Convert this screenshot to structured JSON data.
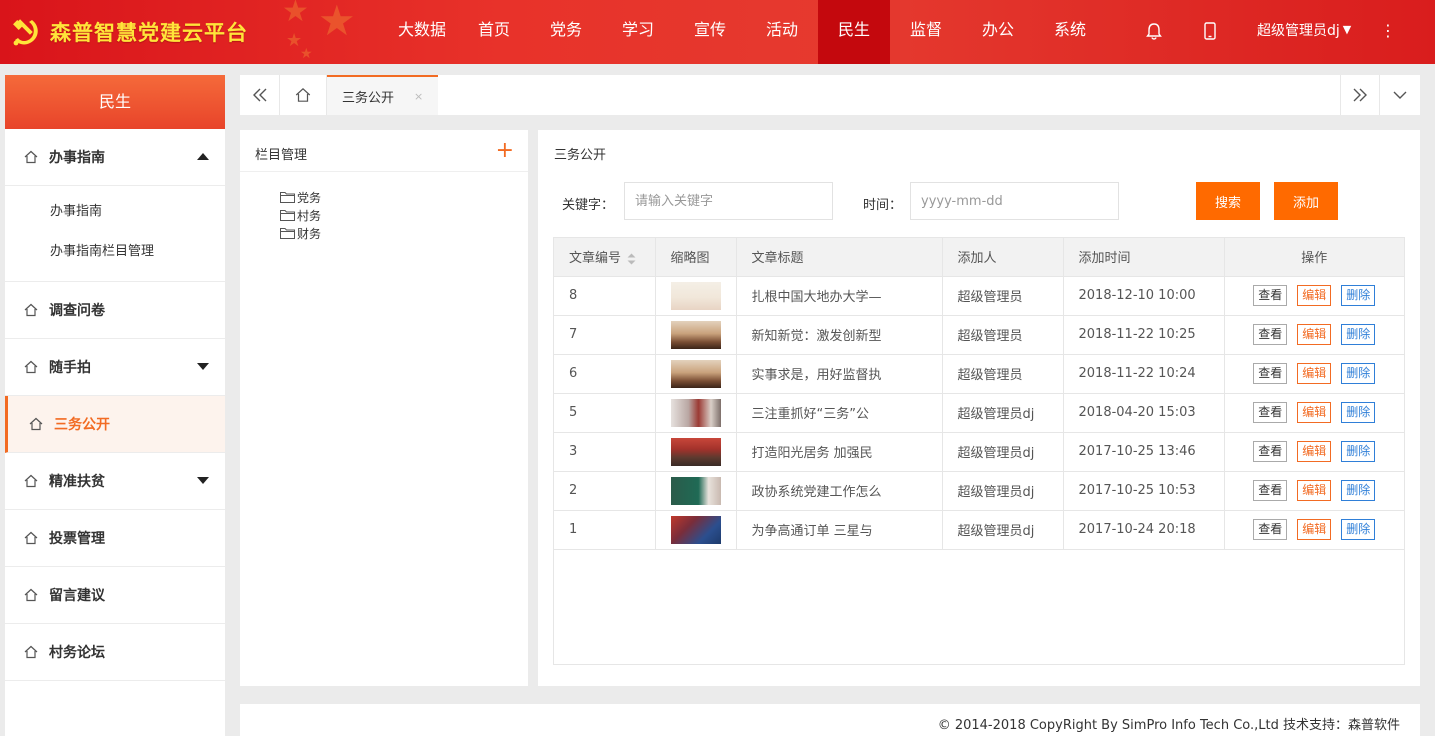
{
  "colors": {
    "header_red": "#e53a2f",
    "logo_yellow": "#ffe43a",
    "accent_orange": "#f26b23",
    "button_orange": "#ff6a00",
    "delete_blue": "#2f7fd8"
  },
  "header": {
    "title": "森普智慧党建云平台",
    "logo_icon": "hammer-sickle-icon",
    "nav": [
      {
        "label": "大数据",
        "active": false
      },
      {
        "label": "首页",
        "active": false
      },
      {
        "label": "党务",
        "active": false
      },
      {
        "label": "学习",
        "active": false
      },
      {
        "label": "宣传",
        "active": false
      },
      {
        "label": "活动",
        "active": false
      },
      {
        "label": "民生",
        "active": true
      },
      {
        "label": "监督",
        "active": false
      },
      {
        "label": "办公",
        "active": false
      },
      {
        "label": "系统",
        "active": false
      }
    ],
    "icons": [
      "bell-icon",
      "mobile-icon",
      "more-vertical-icon"
    ],
    "user": "超级管理员dj"
  },
  "sidebar": {
    "title": "民生",
    "items": [
      {
        "label": "办事指南",
        "icon": "home-icon",
        "expandable": true,
        "expanded": true,
        "children": [
          {
            "label": "办事指南"
          },
          {
            "label": "办事指南栏目管理"
          }
        ]
      },
      {
        "label": "调查问卷",
        "icon": "home-icon",
        "expandable": false
      },
      {
        "label": "随手拍",
        "icon": "home-icon",
        "expandable": true,
        "expanded": false
      },
      {
        "label": "三务公开",
        "icon": "home-icon",
        "expandable": false,
        "active": true
      },
      {
        "label": "精准扶贫",
        "icon": "home-icon",
        "expandable": true,
        "expanded": false
      },
      {
        "label": "投票管理",
        "icon": "home-icon",
        "expandable": false
      },
      {
        "label": "留言建议",
        "icon": "home-icon",
        "expandable": false
      },
      {
        "label": "村务论坛",
        "icon": "home-icon",
        "expandable": false
      }
    ]
  },
  "tabbar": {
    "icons": [
      "double-chevron-left-icon",
      "home-icon",
      "double-chevron-right-icon",
      "chevron-down-icon"
    ],
    "tabs": [
      {
        "label": "三务公开",
        "close": "×",
        "active": true
      }
    ]
  },
  "category_panel": {
    "title": "栏目管理",
    "add_label": "+",
    "tree": [
      {
        "label": "党务"
      },
      {
        "label": "村务"
      },
      {
        "label": "财务"
      }
    ]
  },
  "content": {
    "title": "三务公开",
    "search": {
      "keyword_label": "关键字：",
      "keyword_placeholder": "请输入关键字",
      "keyword_value": "",
      "time_label": "时间：",
      "time_placeholder": "yyyy-mm-dd",
      "time_value": "",
      "search_button": "搜索",
      "add_button": "添加"
    },
    "table": {
      "columns": [
        "文章编号",
        "缩略图",
        "文章标题",
        "添加人",
        "添加时间",
        "操作"
      ],
      "actions": {
        "view": "查看",
        "edit": "编辑",
        "delete": "删除"
      },
      "rows": [
        {
          "id": "8",
          "title": "扎根中国大地办大学—",
          "author": "超级管理员",
          "time": "2018-12-10 10:00",
          "thumb": "document"
        },
        {
          "id": "7",
          "title": "新知新觉：激发创新型",
          "author": "超级管理员",
          "time": "2018-11-22 10:25",
          "thumb": "meeting"
        },
        {
          "id": "6",
          "title": "实事求是，用好监督执",
          "author": "超级管理员",
          "time": "2018-11-22 10:24",
          "thumb": "meeting"
        },
        {
          "id": "5",
          "title": "三注重抓好“三务”公",
          "author": "超级管理员dj",
          "time": "2018-04-20 15:03",
          "thumb": "crowd"
        },
        {
          "id": "3",
          "title": "打造阳光居务 加强民",
          "author": "超级管理员dj",
          "time": "2017-10-25 13:46",
          "thumb": "stage"
        },
        {
          "id": "2",
          "title": "政协系统党建工作怎么",
          "author": "超级管理员dj",
          "time": "2017-10-25 10:53",
          "thumb": "board"
        },
        {
          "id": "1",
          "title": "为争高通订单 三星与",
          "author": "超级管理员dj",
          "time": "2017-10-24 20:18",
          "thumb": "night"
        }
      ]
    }
  },
  "footer": {
    "text": "© 2014-2018 CopyRight By SimPro Info Tech Co.,Ltd 技术支持：森普软件"
  }
}
